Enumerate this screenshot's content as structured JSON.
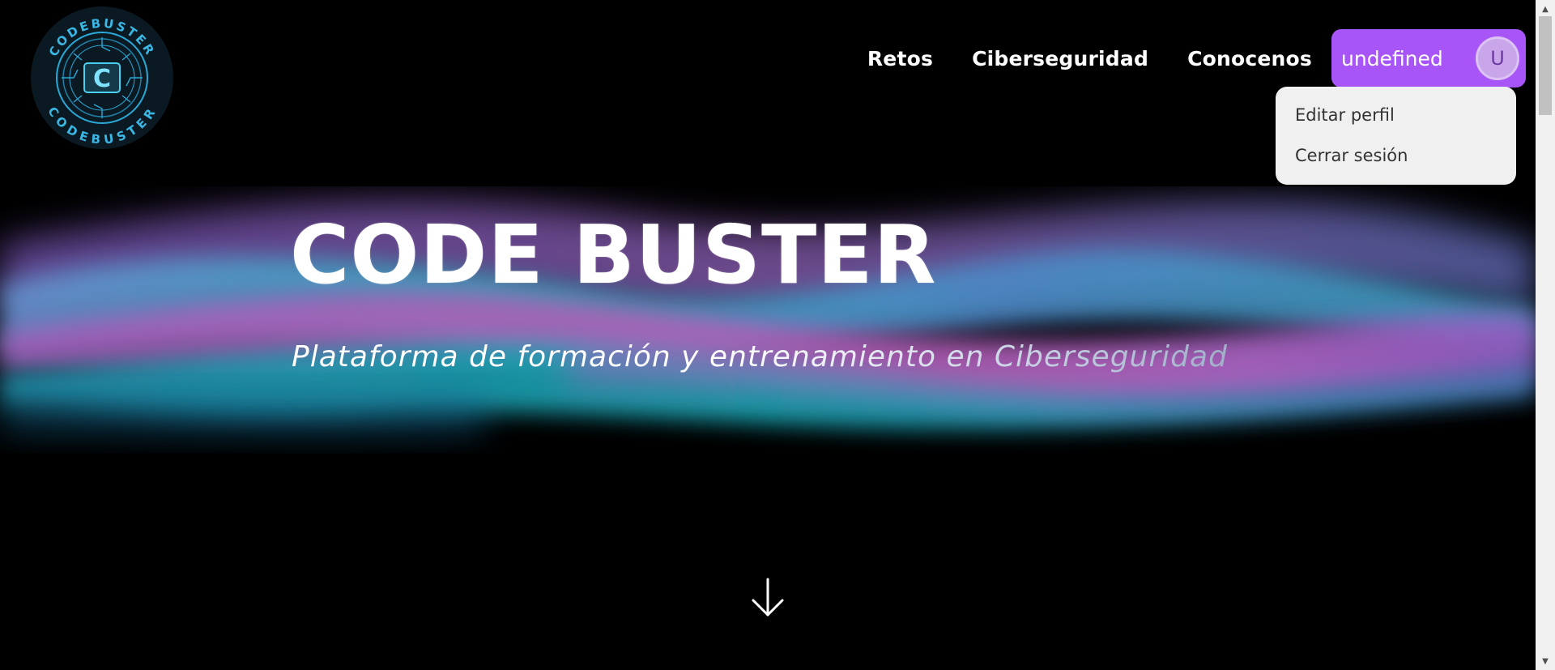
{
  "brand": {
    "logo_icon": "codebuster-circuit-logo",
    "logo_text": "CODEBUSTER",
    "accent_color": "#a855f7"
  },
  "nav": {
    "links": [
      {
        "label": "Retos"
      },
      {
        "label": "Ciberseguridad"
      },
      {
        "label": "Conocenos"
      }
    ],
    "user": {
      "name": "undefined",
      "avatar_initial": "U"
    }
  },
  "user_menu": {
    "items": [
      {
        "label": "Editar perfil"
      },
      {
        "label": "Cerrar sesión"
      }
    ]
  },
  "hero": {
    "title": "CODE BUSTER",
    "subtitle": "Plataforma de formación y entrenamiento en Ciberseguridad",
    "scroll_icon": "arrow-down-icon"
  },
  "scrollbar": {
    "up_icon": "scroll-up-arrow",
    "down_icon": "scroll-down-arrow"
  }
}
